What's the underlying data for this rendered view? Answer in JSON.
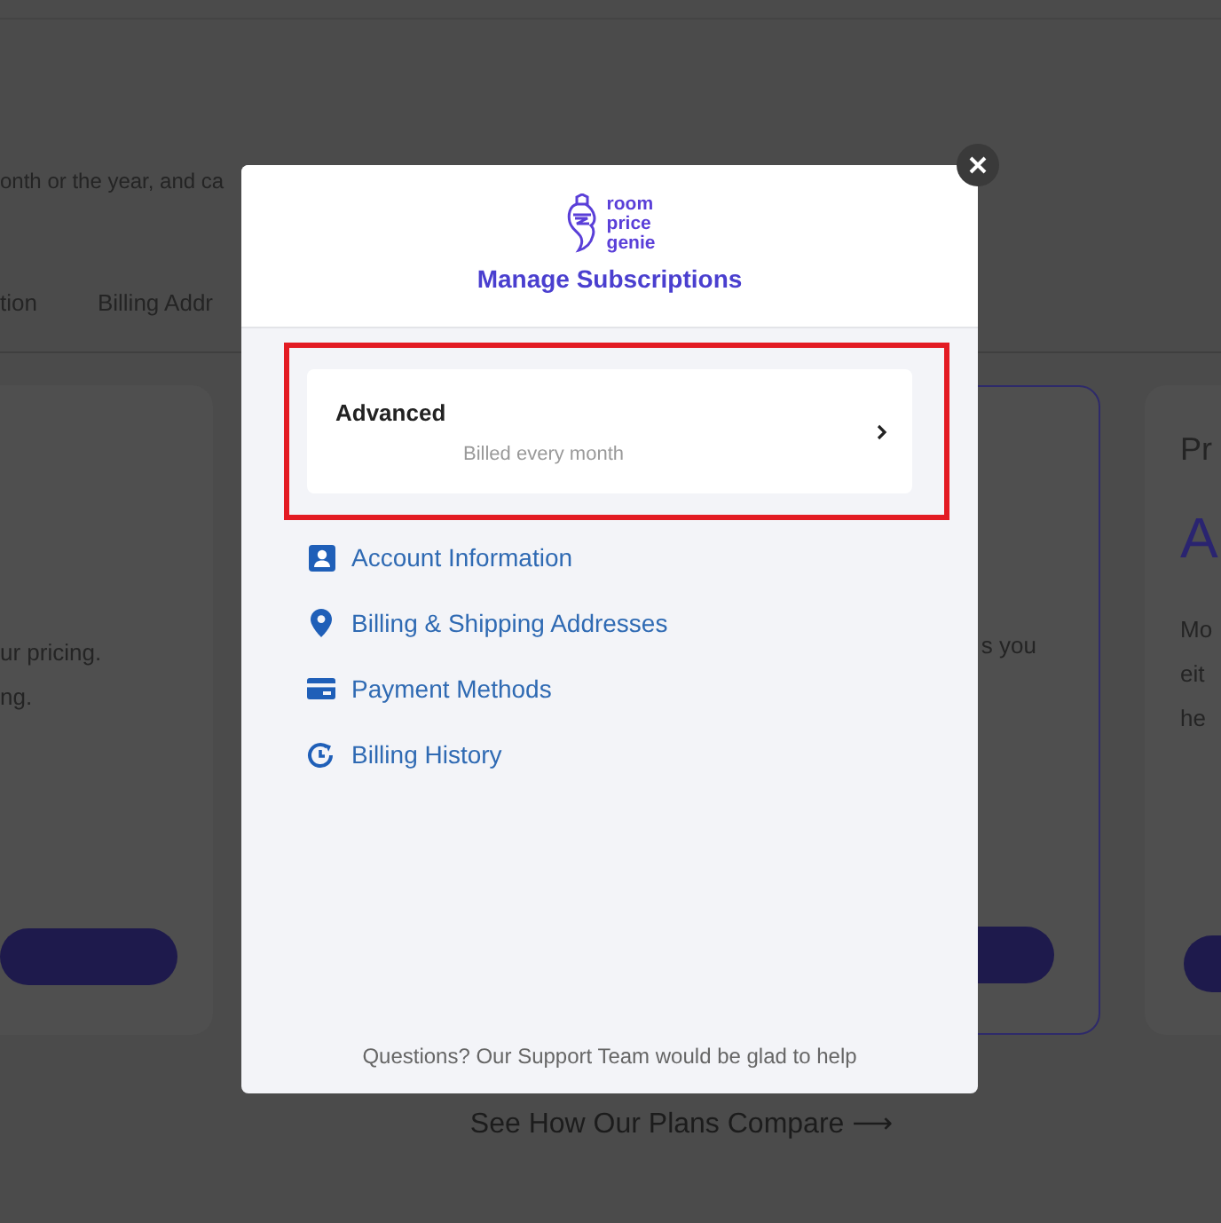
{
  "background": {
    "intro_fragment": "onth or the year, and ca",
    "tabs": [
      {
        "label": "tion"
      },
      {
        "label": "Billing Addr"
      }
    ],
    "left_card": {
      "lines": [
        "ur pricing.",
        "ng."
      ]
    },
    "featured_card": {
      "lines": [
        "s you"
      ]
    },
    "right_card": {
      "heading": "Pr",
      "title": "A",
      "lines": [
        "Mo",
        "eit",
        "he"
      ]
    },
    "compare_link": "See How Our Plans Compare ⟶"
  },
  "modal": {
    "logo_text": [
      "room",
      "price",
      "genie"
    ],
    "title": "Manage Subscriptions",
    "plan": {
      "name": "Advanced",
      "billing": "Billed every month"
    },
    "menu": [
      {
        "label": "Account Information",
        "kind": "account"
      },
      {
        "label": "Billing & Shipping Addresses",
        "kind": "location"
      },
      {
        "label": "Payment Methods",
        "kind": "card"
      },
      {
        "label": "Billing History",
        "kind": "history"
      }
    ],
    "footer": "Questions? Our Support Team would be glad to help"
  }
}
